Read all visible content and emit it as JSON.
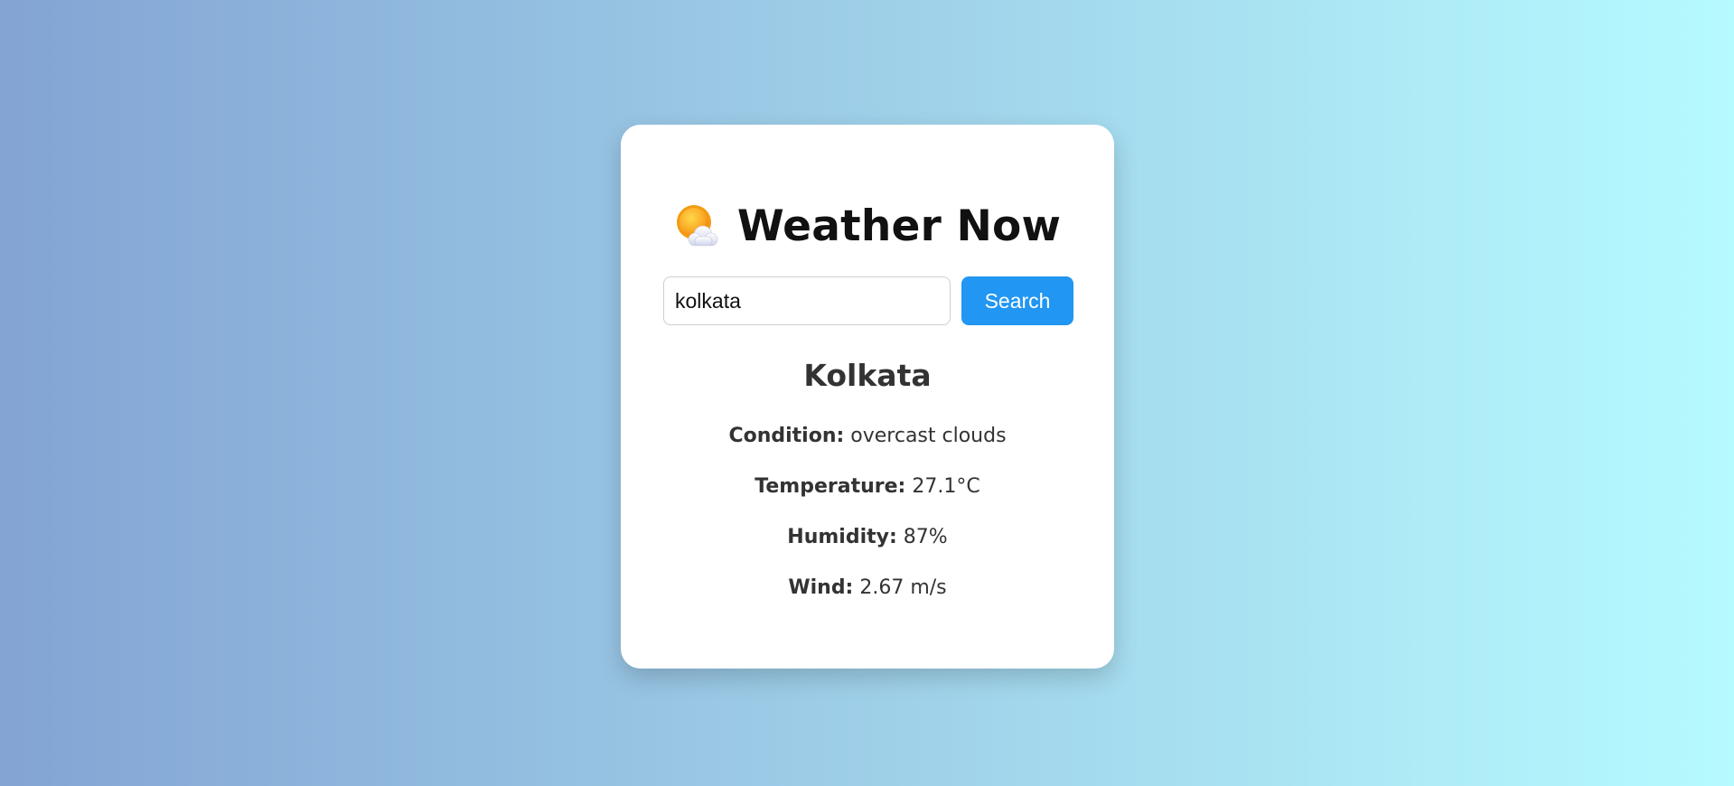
{
  "app": {
    "title": "Weather Now",
    "icon": "sun-behind-cloud-icon"
  },
  "search": {
    "value": "kolkata",
    "placeholder": "",
    "button_label": "Search"
  },
  "result": {
    "city": "Kolkata",
    "details": [
      {
        "label": "Condition:",
        "value": "overcast clouds"
      },
      {
        "label": "Temperature:",
        "value": "27.1°C"
      },
      {
        "label": "Humidity:",
        "value": "87%"
      },
      {
        "label": "Wind:",
        "value": "2.67 m/s"
      }
    ]
  },
  "colors": {
    "accent": "#2196f3",
    "background_start": "#83a4d4",
    "background_end": "#b6fbff",
    "text": "#333333"
  }
}
